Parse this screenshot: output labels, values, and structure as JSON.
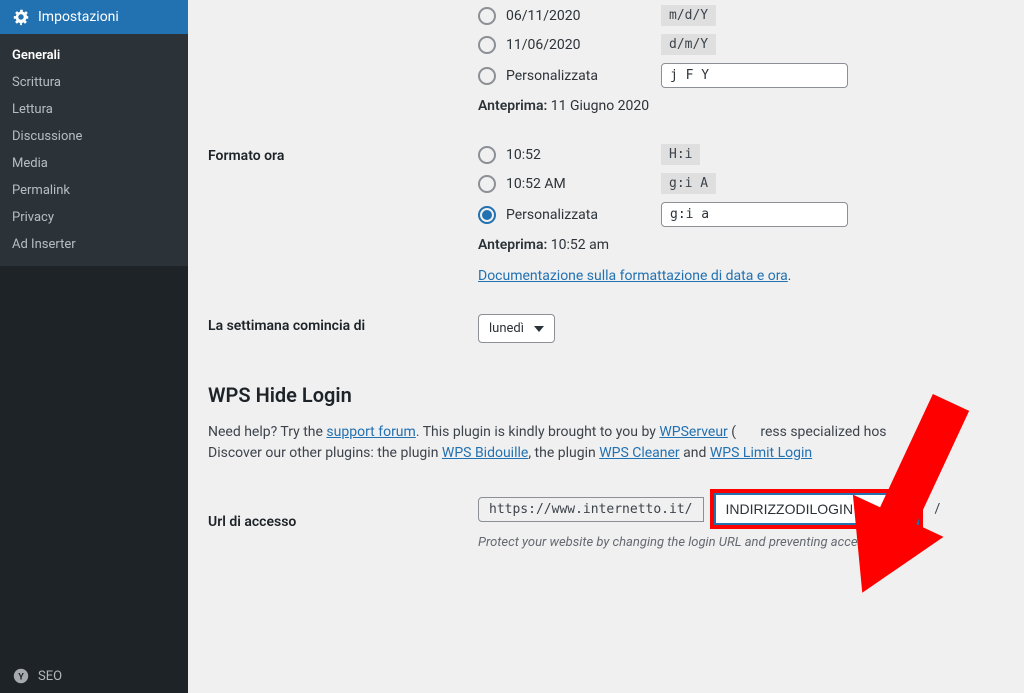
{
  "sidebar": {
    "current": "Impostazioni",
    "items": [
      {
        "label": "Generali",
        "active": true
      },
      {
        "label": "Scrittura"
      },
      {
        "label": "Lettura"
      },
      {
        "label": "Discussione"
      },
      {
        "label": "Media"
      },
      {
        "label": "Permalink"
      },
      {
        "label": "Privacy"
      },
      {
        "label": "Ad Inserter"
      }
    ],
    "bottom": "SEO"
  },
  "date_format": {
    "option2": {
      "label": "06/11/2020",
      "code": "m/d/Y"
    },
    "option3": {
      "label": "11/06/2020",
      "code": "d/m/Y"
    },
    "option4": {
      "label": "Personalizzata",
      "value": "j F Y"
    },
    "preview_label": "Anteprima:",
    "preview_value": "11 Giugno 2020"
  },
  "time_format": {
    "label": "Formato ora",
    "option1": {
      "label": "10:52",
      "code": "H:i"
    },
    "option2": {
      "label": "10:52 AM",
      "code": "g:i A"
    },
    "option3": {
      "label": "Personalizzata",
      "value": "g:i a"
    },
    "preview_label": "Anteprima:",
    "preview_value": "10:52 am",
    "doc_link": "Documentazione sulla formattazione di data e ora"
  },
  "week_start": {
    "label": "La settimana comincia di",
    "value": "lunedì"
  },
  "wps": {
    "title": "WPS Hide Login",
    "help_prefix": "Need help? Try the ",
    "support_link": "support forum",
    "help_mid": ". This plugin is kindly brought to you by ",
    "wpserveur": "WPServeur",
    "wpserveur_tail": "ress specialized hos",
    "line2_prefix": "Discover our other plugins: the plugin ",
    "bidouille": "WPS Bidouille",
    "line2_mid1": ", the plugin ",
    "cleaner": "WPS Cleaner",
    "line2_mid2": " and ",
    "limit": "WPS Limit Login",
    "url_label": "Url di accesso",
    "url_prefix": "https://www.internetto.it/",
    "url_value": "INDIRIZZODILOGIN",
    "url_suffix": "/",
    "url_desc": "Protect your website by changing the login URL and preventing access"
  }
}
